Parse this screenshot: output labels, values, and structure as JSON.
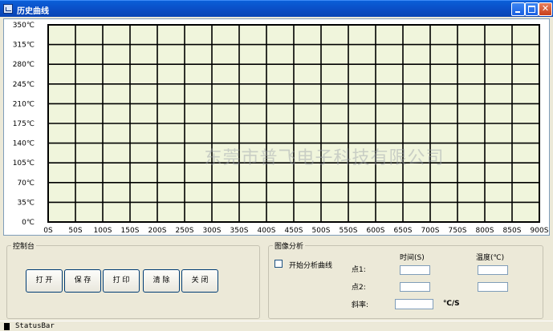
{
  "window": {
    "title": "历史曲线"
  },
  "chart_data": {
    "type": "line",
    "title": "",
    "xlabel": "",
    "ylabel": "",
    "x_ticks": [
      "0S",
      "50S",
      "100S",
      "150S",
      "200S",
      "250S",
      "300S",
      "350S",
      "400S",
      "450S",
      "500S",
      "550S",
      "600S",
      "650S",
      "700S",
      "750S",
      "800S",
      "850S",
      "900S"
    ],
    "y_ticks": [
      "350℃",
      "315℃",
      "280℃",
      "245℃",
      "210℃",
      "175℃",
      "140℃",
      "105℃",
      "70℃",
      "35℃",
      "0℃"
    ],
    "xlim": [
      0,
      900
    ],
    "ylim": [
      0,
      350
    ],
    "grid": true,
    "series": [],
    "plot_background": "#f0f5dc",
    "grid_color": "#000000",
    "watermark": "东莞市普飞电子科技有限公司"
  },
  "control_panel": {
    "title": "控制台",
    "buttons": {
      "open": "打 开",
      "save": "保 存",
      "print": "打 印",
      "clear": "清 除",
      "close": "关 闭"
    }
  },
  "analysis_panel": {
    "title": "图像分析",
    "checkbox_label": "开始分析曲线",
    "checkbox_checked": false,
    "col_time": "时间(S)",
    "col_temp": "温度(℃)",
    "point1_label": "点1:",
    "point2_label": "点2:",
    "slope_label": "斜率:",
    "slope_unit": "℃/S",
    "point1_time": "",
    "point1_temp": "",
    "point2_time": "",
    "point2_temp": "",
    "slope_value": ""
  },
  "statusbar": {
    "text": "StatusBar"
  }
}
